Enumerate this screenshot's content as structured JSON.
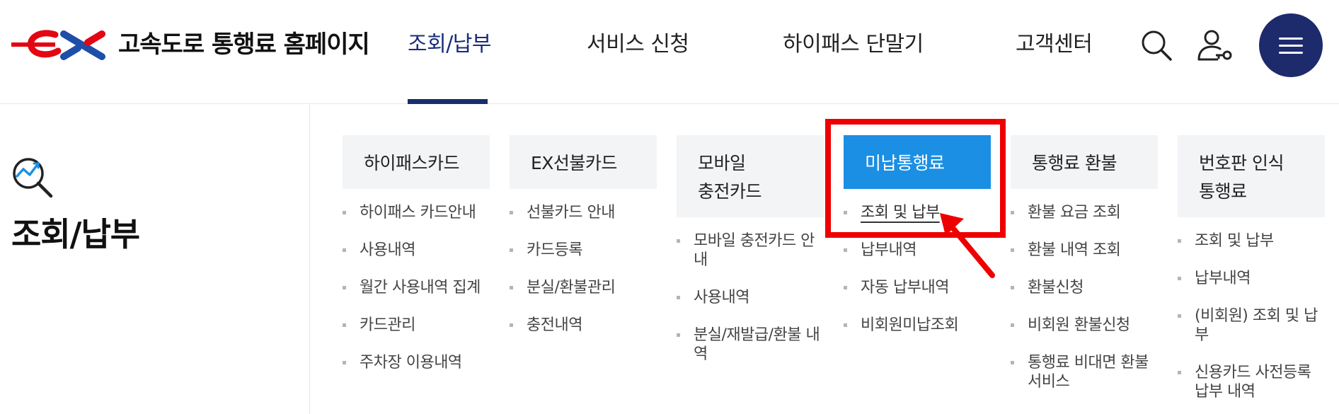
{
  "header": {
    "site_title": "고속도로 통행료 홈페이지",
    "logo_icon": "ex-logo",
    "nav": [
      {
        "label": "조회/납부",
        "active": true
      },
      {
        "label": "서비스 신청",
        "active": false
      },
      {
        "label": "하이패스 단말기",
        "active": false
      },
      {
        "label": "고객센터",
        "active": false
      }
    ],
    "icons": [
      "search-icon",
      "user-key-icon",
      "menu-icon"
    ]
  },
  "left_panel": {
    "icon": "magnifier-chart-icon",
    "title": "조회/납부"
  },
  "columns": [
    {
      "heading": [
        "하이패스카드"
      ],
      "items": [
        "하이패스 카드안내",
        "사용내역",
        "월간 사용내역 집계",
        "카드관리",
        "주차장 이용내역"
      ]
    },
    {
      "heading": [
        "EX선불카드"
      ],
      "items": [
        "선불카드 안내",
        "카드등록",
        "분실/환불관리",
        "충전내역"
      ]
    },
    {
      "heading": [
        "모바일",
        "충전카드"
      ],
      "items": [
        [
          "모바일 충전카드 안",
          "내"
        ],
        "사용내역",
        [
          "분실/재발급/환불 내",
          "역"
        ]
      ]
    },
    {
      "heading": [
        "미납통행료"
      ],
      "highlight": true,
      "items": [
        "조회 및 납부",
        "납부내역",
        "자동 납부내역",
        "비회원미납조회"
      ],
      "selected_index": 0
    },
    {
      "heading": [
        "통행료 환불"
      ],
      "items": [
        "환불 요금 조회",
        "환불 내역 조회",
        "환불신청",
        "비회원 환불신청",
        [
          "통행료 비대면 환불",
          "서비스"
        ]
      ]
    },
    {
      "heading": [
        "번호판 인식",
        "통행료"
      ],
      "items": [
        "조회 및 납부",
        "납부내역",
        [
          "(비회원) 조회 및 납",
          "부"
        ],
        [
          "신용카드 사전등록",
          "납부 내역"
        ]
      ]
    }
  ],
  "colors": {
    "brand_navy": "#1d2a6c",
    "highlight_blue": "#1b8fe3",
    "annotation_red": "#ee0000"
  }
}
